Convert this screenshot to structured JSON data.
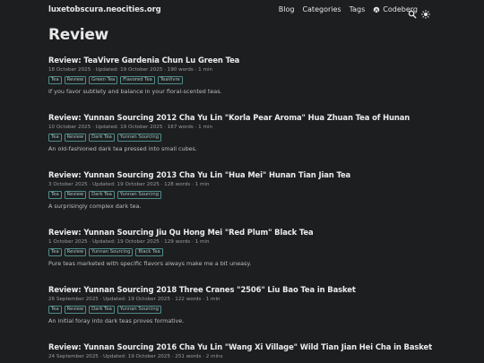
{
  "site": {
    "title": "luxetobscura.neocities.org",
    "nav": {
      "blog": "Blog",
      "categories": "Categories",
      "tags": "Tags",
      "codeberg": "Codeberg"
    }
  },
  "page": {
    "title": "Review"
  },
  "posts": [
    {
      "title": "Review: TeaVivre Gardenia Chun Lu Green Tea",
      "meta": "18 October 2025 · Updated: 19 October 2025 · 190 words · 1 min",
      "tags": [
        "Tea",
        "Review",
        "Green Tea",
        "Flavored Tea",
        "TeaVivre"
      ],
      "summary": "If you favor subtlety and balance in your floral-scented teas."
    },
    {
      "title": "Review: Yunnan Sourcing 2012 Cha Yu Lin \"Korla Pear Aroma\" Hua Zhuan Tea of Hunan",
      "meta": "10 October 2025 · Updated: 19 October 2025 · 167 words · 1 min",
      "tags": [
        "Tea",
        "Review",
        "Dark Tea",
        "Yunnan Sourcing"
      ],
      "summary": "An old-fashioned dark tea pressed into small cubes."
    },
    {
      "title": "Review: Yunnan Sourcing 2013 Cha Yu Lin \"Hua Mei\" Hunan Tian Jian Tea",
      "meta": "3 October 2025 · Updated: 19 October 2025 · 128 words · 1 min",
      "tags": [
        "Tea",
        "Review",
        "Dark Tea",
        "Yunnan Sourcing"
      ],
      "summary": "A surprisingly complex dark tea."
    },
    {
      "title": "Review: Yunnan Sourcing Jiu Qu Hong Mei \"Red Plum\" Black Tea",
      "meta": "1 October 2025 · Updated: 19 October 2025 · 129 words · 1 min",
      "tags": [
        "Tea",
        "Review",
        "Yunnan Sourcing",
        "Black Tea"
      ],
      "summary": "Pure teas marketed with specific flavors always make me a bit uneasy."
    },
    {
      "title": "Review: Yunnan Sourcing 2018 Three Cranes \"2506\" Liu Bao Tea in Basket",
      "meta": "26 September 2025 · Updated: 19 October 2025 · 122 words · 1 min",
      "tags": [
        "Tea",
        "Review",
        "Dark Tea",
        "Yunnan Sourcing"
      ],
      "summary": "An initial foray into dark teas proves formative."
    },
    {
      "title": "Review: Yunnan Sourcing 2016 Cha Yu Lin \"Wang Xi Village\" Wild Tian Jian Hei Cha in Basket",
      "meta": "24 September 2025 · Updated: 19 October 2025 · 251 words · 2 mins",
      "tags": [],
      "summary": ""
    }
  ]
}
